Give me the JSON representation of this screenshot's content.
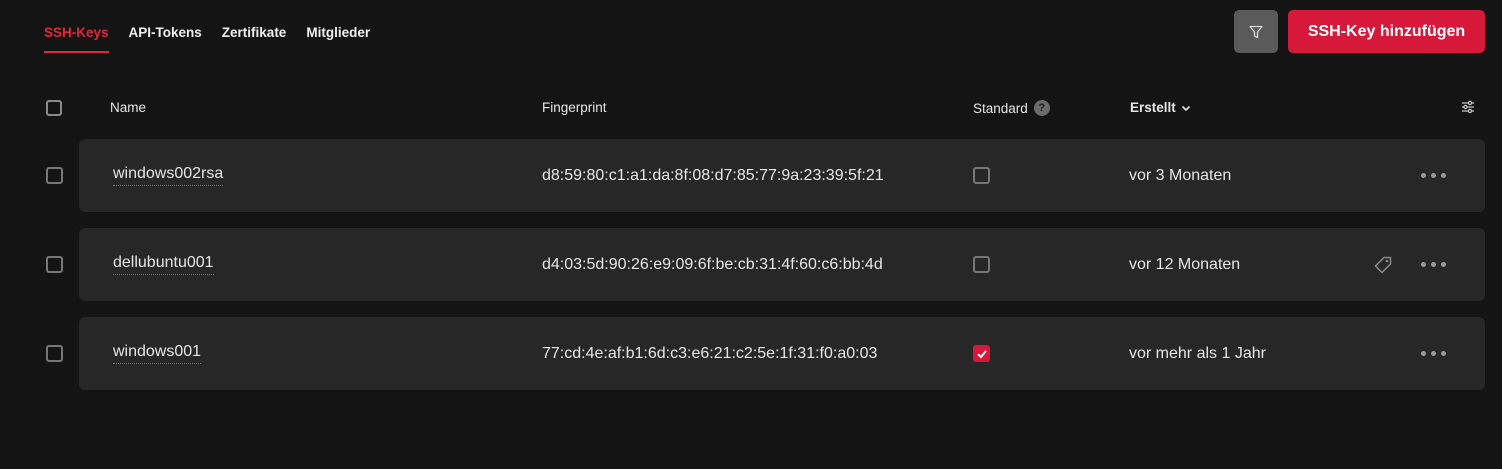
{
  "tabs": [
    {
      "label": "SSH-Keys",
      "active": true
    },
    {
      "label": "API-Tokens",
      "active": false
    },
    {
      "label": "Zertifikate",
      "active": false
    },
    {
      "label": "Mitglieder",
      "active": false
    }
  ],
  "toolbar": {
    "filter_icon": "filter-icon",
    "add_label": "SSH-Key hinzufügen"
  },
  "table": {
    "headers": {
      "name": "Name",
      "fingerprint": "Fingerprint",
      "standard": "Standard",
      "standard_help": "?",
      "created": "Erstellt"
    },
    "rows": [
      {
        "name": "windows002rsa",
        "fingerprint": "d8:59:80:c1:a1:da:8f:08:d7:85:77:9a:23:39:5f:21",
        "standard": false,
        "created": "vor 3 Monaten"
      },
      {
        "name": "dellubuntu001",
        "fingerprint": "d4:03:5d:90:26:e9:09:6f:be:cb:31:4f:60:c6:bb:4d",
        "standard": false,
        "created": "vor 12 Monaten"
      },
      {
        "name": "windows001",
        "fingerprint": "77:cd:4e:af:b1:6d:c3:e6:21:c2:5e:1f:31:f0:a0:03",
        "standard": true,
        "created": "vor mehr als 1 Jahr"
      }
    ]
  },
  "colors": {
    "accent": "#d6193b",
    "background": "#141414",
    "row_background": "#272727"
  }
}
